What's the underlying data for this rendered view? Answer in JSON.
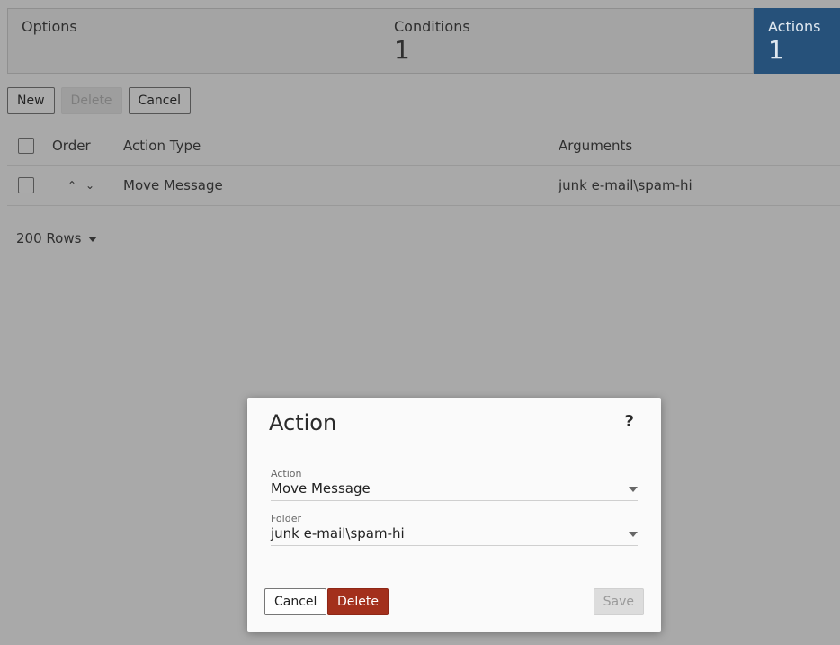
{
  "tabs": {
    "options": {
      "label": "Options"
    },
    "conditions": {
      "label": "Conditions",
      "count": "1"
    },
    "actions": {
      "label": "Actions",
      "count": "1"
    }
  },
  "toolbar": {
    "new_label": "New",
    "delete_label": "Delete",
    "cancel_label": "Cancel"
  },
  "grid": {
    "headers": {
      "order": "Order",
      "action_type": "Action Type",
      "arguments": "Arguments"
    },
    "rows": [
      {
        "action_type": "Move Message",
        "arguments": "junk e-mail\\spam-hi"
      }
    ]
  },
  "pager": {
    "rows_label": "200 Rows"
  },
  "dialog": {
    "title": "Action",
    "help": "?",
    "action_field": {
      "label": "Action",
      "value": "Move Message"
    },
    "folder_field": {
      "label": "Folder",
      "value": "junk e-mail\\spam-hi"
    },
    "cancel_label": "Cancel",
    "delete_label": "Delete",
    "save_label": "Save"
  },
  "colors": {
    "active_tab": "#26517a",
    "delete_button": "#a3301c"
  }
}
